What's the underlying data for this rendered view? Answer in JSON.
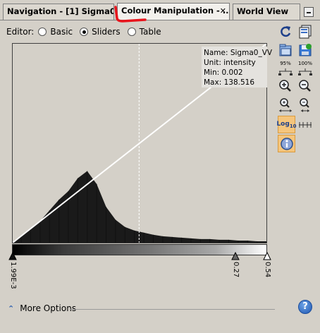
{
  "tabs": [
    {
      "label": "Navigation - [1] Sigma0..."
    },
    {
      "label": "Colour Manipulation - ...",
      "close": "✕"
    },
    {
      "label": "World View"
    }
  ],
  "editor": {
    "label": "Editor:",
    "options": [
      "Basic",
      "Sliders",
      "Table"
    ],
    "selected": "Sliders"
  },
  "info": {
    "name": "Name: Sigma0_VV",
    "unit": "Unit: intensity",
    "min": "Min: 0.002",
    "max": "Max: 138.516"
  },
  "sliders": {
    "labels": [
      "1.99E-3",
      "0.27",
      "0.54"
    ],
    "values": [
      0.00199,
      0.27,
      0.54
    ]
  },
  "toolbar": {
    "zoom95_label": "95%",
    "zoom100_label": "100%",
    "log_label": "Log",
    "log_sub": "10"
  },
  "more_options": {
    "label": "More Options"
  },
  "help": {
    "label": "?"
  },
  "colors": {
    "accent": "#f5c57c",
    "red_mark": "#e8141c"
  },
  "chart_data": {
    "type": "area",
    "title": "",
    "xlabel": "",
    "ylabel": "",
    "xlim": [
      0.00199,
      0.54
    ],
    "x": [
      0.00199,
      0.02,
      0.04,
      0.06,
      0.08,
      0.1,
      0.12,
      0.14,
      0.16,
      0.18,
      0.2,
      0.22,
      0.24,
      0.26,
      0.28,
      0.3,
      0.32,
      0.34,
      0.36,
      0.38,
      0.4,
      0.42,
      0.44,
      0.46,
      0.48,
      0.5,
      0.52,
      0.54
    ],
    "values": [
      0,
      0.09,
      0.19,
      0.3,
      0.45,
      0.6,
      0.72,
      0.9,
      1.0,
      0.82,
      0.5,
      0.32,
      0.22,
      0.17,
      0.14,
      0.11,
      0.09,
      0.08,
      0.07,
      0.06,
      0.05,
      0.05,
      0.04,
      0.04,
      0.03,
      0.03,
      0.02,
      0.02
    ]
  }
}
